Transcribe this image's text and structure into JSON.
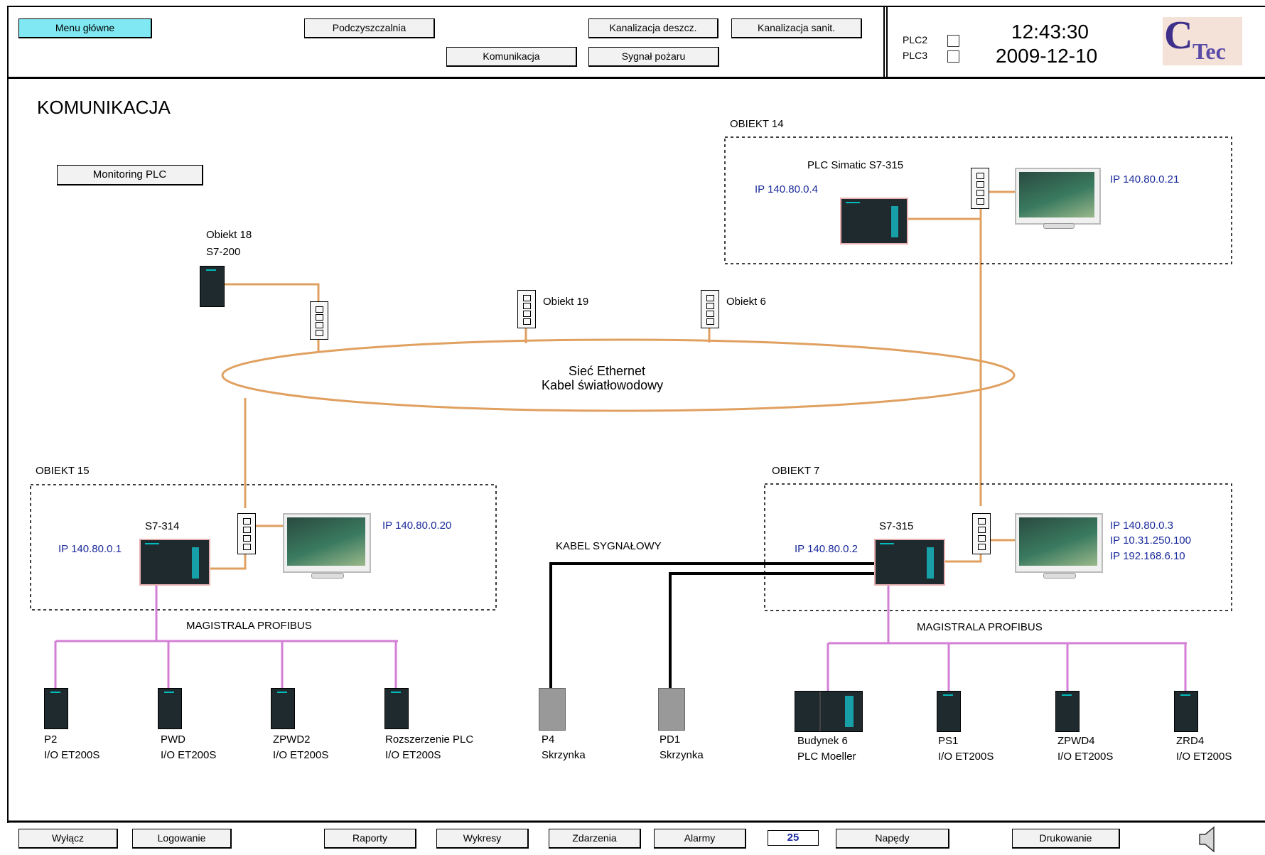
{
  "header": {
    "nav_buttons": [
      {
        "label": "Menu główne",
        "active": true
      },
      {
        "label": "Podczyszczalnia",
        "active": false
      },
      {
        "label": "Kanalizacja deszcz.",
        "active": false
      },
      {
        "label": "Kanalizacja sanit.",
        "active": false
      },
      {
        "label": "Komunikacja",
        "active": false
      },
      {
        "label": "Sygnał pożaru",
        "active": false
      }
    ],
    "plc_status": [
      {
        "label": "PLC2",
        "checked": false
      },
      {
        "label": "PLC3",
        "checked": false
      }
    ],
    "time": "12:43:30",
    "date": "2009-12-10",
    "logo": {
      "top": "C",
      "bottom": "Tec",
      "colors": {
        "c": "#3d2f8a",
        "tec": "#5a4aa8",
        "bg": "#f4e2d8"
      }
    }
  },
  "main": {
    "page_title": "KOMUNIKACJA",
    "monitoring_button": "Monitoring PLC",
    "network_label_1": "Sieć Ethernet",
    "network_label_2": "Kabel światłowodowy",
    "signal_cable_label": "KABEL SYGNAŁOWY",
    "objects": {
      "obj14": {
        "label": "OBIEKT 14",
        "plc_label": "PLC Simatic S7-315",
        "plc_ip": "IP 140.80.0.4",
        "hmi_ip": "IP 140.80.0.21"
      },
      "obj15": {
        "label": "OBIEKT 15",
        "plc_label": "S7-314",
        "plc_ip": "IP 140.80.0.1",
        "hmi_ip": "IP 140.80.0.20",
        "bus_label": "MAGISTRALA PROFIBUS"
      },
      "obj7": {
        "label": "OBIEKT 7",
        "plc_label": "S7-315",
        "plc_ip": "IP 140.80.0.2",
        "hmi_ips": [
          "IP 140.80.0.3",
          "IP 10.31.250.100",
          "IP 192.168.6.10"
        ],
        "bus_label": "MAGISTRALA PROFIBUS"
      },
      "obj18": {
        "line1": "Obiekt 18",
        "line2": "S7-200"
      },
      "obj19": {
        "label": "Obiekt 19"
      },
      "obj6": {
        "label": "Obiekt 6"
      }
    },
    "left_devices": [
      {
        "name": "P2",
        "type": "I/O ET200S"
      },
      {
        "name": "PWD",
        "type": "I/O ET200S"
      },
      {
        "name": "ZPWD2",
        "type": "I/O ET200S"
      },
      {
        "name": "Rozszerzenie PLC",
        "type": "I/O ET200S"
      }
    ],
    "signal_devices": [
      {
        "name": "P4",
        "type": "Skrzynka"
      },
      {
        "name": "PD1",
        "type": "Skrzynka"
      }
    ],
    "right_devices": [
      {
        "name": "Budynek 6",
        "type": "PLC Moeller"
      },
      {
        "name": "PS1",
        "type": "I/O ET200S"
      },
      {
        "name": "ZPWD4",
        "type": "I/O ET200S"
      },
      {
        "name": "ZRD4",
        "type": "I/O ET200S"
      }
    ]
  },
  "footer": {
    "buttons": [
      "Wyłącz",
      "Logowanie",
      "Raporty",
      "Wykresy",
      "Zdarzenia",
      "Alarmy",
      "Napędy",
      "Drukowanie"
    ],
    "counter": "25",
    "speaker_icon": "speaker-icon"
  },
  "colors": {
    "ethernet": "#e0a060",
    "profibus": "#d47fd6",
    "signal": "#000000",
    "ip_text": "#1a2a9a",
    "active_button": "#7fe8f2"
  }
}
